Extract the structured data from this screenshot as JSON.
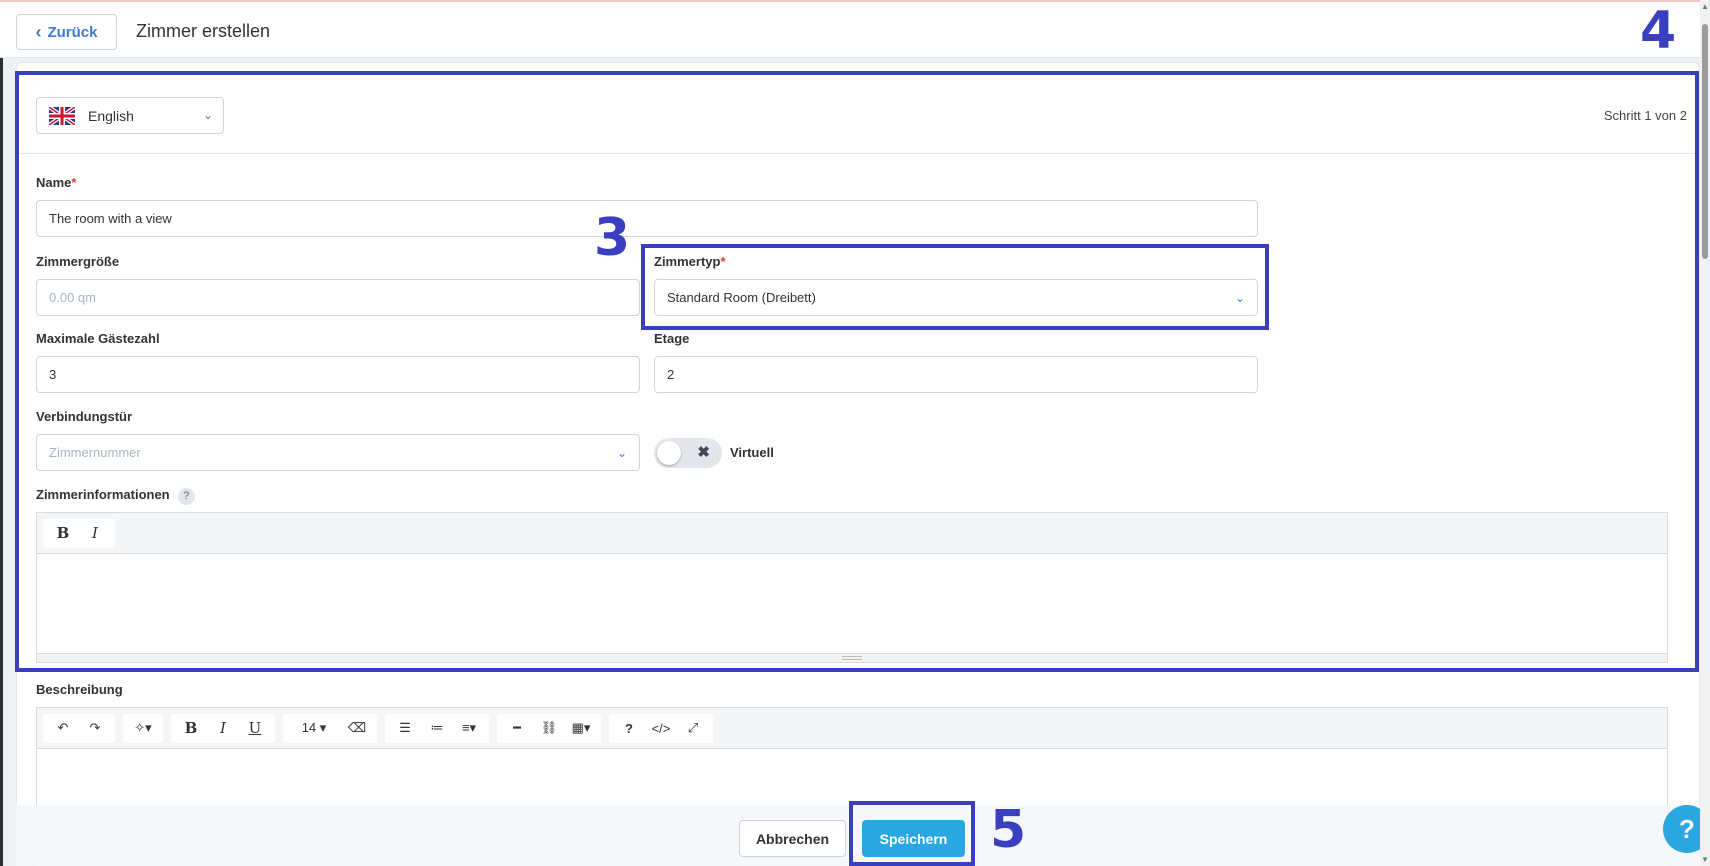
{
  "header": {
    "back_label": "Zurück",
    "title": "Zimmer erstellen"
  },
  "language": {
    "selected": "English"
  },
  "step": "Schritt 1 von 2",
  "form": {
    "name": {
      "label": "Name",
      "required_mark": "*",
      "value": "The room with a view"
    },
    "room_size": {
      "label": "Zimmergröße",
      "placeholder": "0.00 qm"
    },
    "room_type": {
      "label": "Zimmertyp",
      "required_mark": "*",
      "value": "Standard Room (Dreibett)"
    },
    "max_guests": {
      "label": "Maximale Gästezahl",
      "value": "3"
    },
    "floor": {
      "label": "Etage",
      "value": "2"
    },
    "connecting_door": {
      "label": "Verbindungstür",
      "placeholder": "Zimmernummer"
    },
    "virtual": {
      "label": "Virtuell",
      "on": false
    },
    "room_info": {
      "label": "Zimmerinformationen",
      "help": "?",
      "toolbar": [
        "B",
        "I"
      ]
    },
    "description": {
      "label": "Beschreibung",
      "font_size": "14 ▾"
    }
  },
  "footer": {
    "cancel_label": "Abbrechen",
    "save_label": "Speichern"
  },
  "annotations": {
    "n3": "3",
    "n4": "4",
    "n5": "5"
  },
  "help_fab": "?",
  "colors": {
    "primary": "#2aa7e0",
    "annotation": "#3a3fbf",
    "required": "#e53935"
  }
}
